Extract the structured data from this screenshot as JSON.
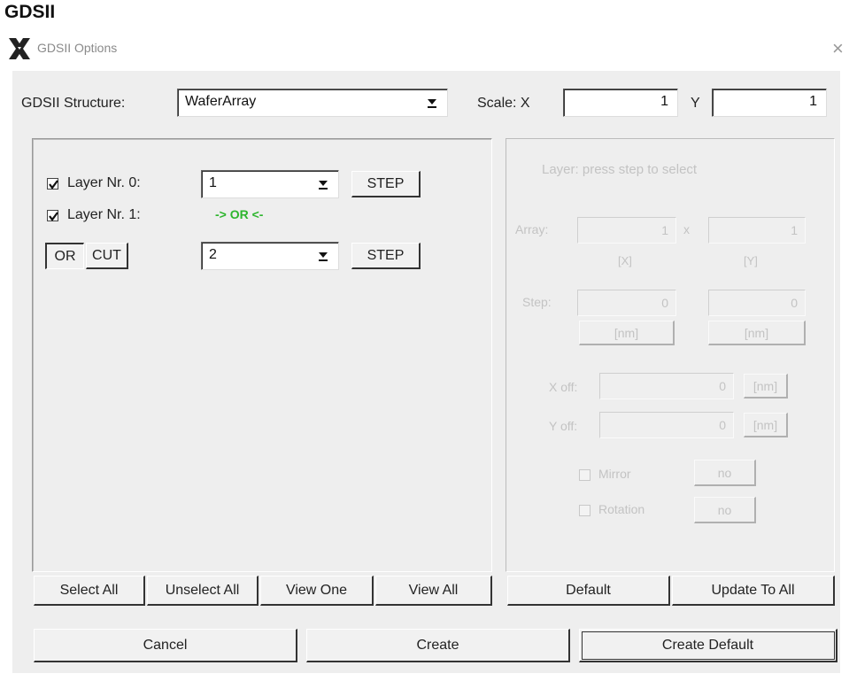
{
  "page_heading": "GDSII",
  "window": {
    "title": "GDSII Options",
    "close_glyph": "×",
    "icon": "x-app-icon"
  },
  "structure": {
    "label": "GDSII Structure:",
    "value": "WaferArray"
  },
  "scale": {
    "label": "Scale: X",
    "x_value": "1",
    "y_label": "Y",
    "y_value": "1"
  },
  "layers": {
    "layer0": {
      "label": "Layer Nr. 0:",
      "checked": true,
      "value": "1",
      "step_label": "STEP"
    },
    "layer1": {
      "label": "Layer Nr. 1:",
      "checked": true,
      "operation": "-> OR <-",
      "operation_color": "#2db52d"
    },
    "mode": {
      "or_label": "OR",
      "cut_label": "CUT",
      "value": "2",
      "step_label": "STEP"
    }
  },
  "left_buttons": {
    "select_all": "Select All",
    "unselect_all": "Unselect All",
    "view_one": "View One",
    "view_all": "View All"
  },
  "right_panel": {
    "hint": "Layer: press step to select",
    "array_label": "Array:",
    "array_x": "1",
    "array_sep": "x",
    "array_y": "1",
    "x_unit_label": "[X]",
    "y_unit_label": "[Y]",
    "step_label": "Step:",
    "step_x": "0",
    "step_y": "0",
    "step_x_unit": "[nm]",
    "step_y_unit": "[nm]",
    "xoff_label": "X off:",
    "xoff_value": "0",
    "xoff_unit": "[nm]",
    "yoff_label": "Y off:",
    "yoff_value": "0",
    "yoff_unit": "[nm]",
    "mirror_label": "Mirror",
    "mirror_value": "no",
    "rotation_label": "Rotation",
    "rotation_value": "no"
  },
  "right_buttons": {
    "default": "Default",
    "update_to_all": "Update To All"
  },
  "bottom_buttons": {
    "cancel": "Cancel",
    "create": "Create",
    "create_default": "Create Default"
  }
}
